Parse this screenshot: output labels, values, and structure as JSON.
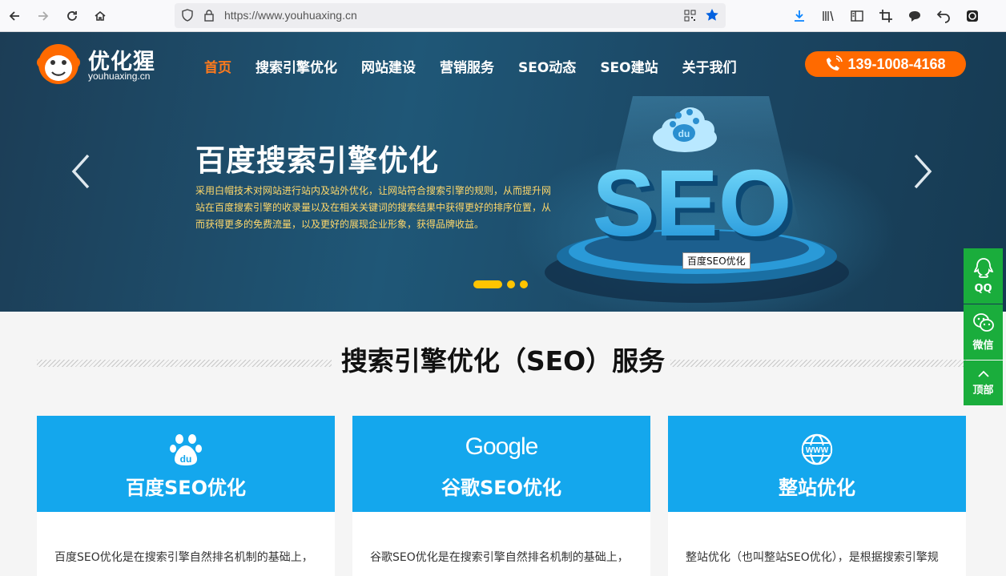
{
  "browser": {
    "url": "https://www.youhuaxing.cn"
  },
  "site": {
    "logo_cn": "优化猩",
    "logo_en": "youhuaxing.cn",
    "nav": [
      "首页",
      "搜索引擎优化",
      "网站建设",
      "营销服务",
      "SEO动态",
      "SEO建站",
      "关于我们"
    ],
    "phone": "139-1008-4168"
  },
  "hero": {
    "title": "百度搜索引擎优化",
    "description": "采用白帽技术对网站进行站内及站外优化，让网站符合搜索引擎的规则，从而提升网站在百度搜索引擎的收录量以及在相关关键词的搜索结果中获得更好的排序位置，从而获得更多的免费流量，以及更好的展现企业形象，获得品牌收益。",
    "graphic_text": "SEO",
    "baidu_mark": "du",
    "tooltip": "百度SEO优化"
  },
  "section": {
    "title": "搜索引擎优化（SEO）服务"
  },
  "cards": [
    {
      "title": "百度SEO优化",
      "icon": "baidu-paw-icon",
      "text": "百度SEO优化是在搜索引擎自然排名机制的基础上，"
    },
    {
      "title": "谷歌SEO优化",
      "icon": "google-logo",
      "logo_text": "Google",
      "text": "谷歌SEO优化是在搜索引擎自然排名机制的基础上，"
    },
    {
      "title": "整站优化",
      "icon": "www-globe-icon",
      "logo_text": "WWW",
      "text": "整站优化（也叫整站SEO优化），是根据搜索引擎规"
    }
  ],
  "sidebar": [
    {
      "label": "QQ",
      "icon": "qq-icon"
    },
    {
      "label": "微信",
      "icon": "wechat-icon"
    },
    {
      "label": "顶部",
      "icon": "up-arrow-icon"
    }
  ],
  "colors": {
    "accent": "#ff6a00",
    "card_blue": "#14a7ed",
    "side_green": "#1aad3c",
    "dot_yellow": "#ffc400"
  }
}
